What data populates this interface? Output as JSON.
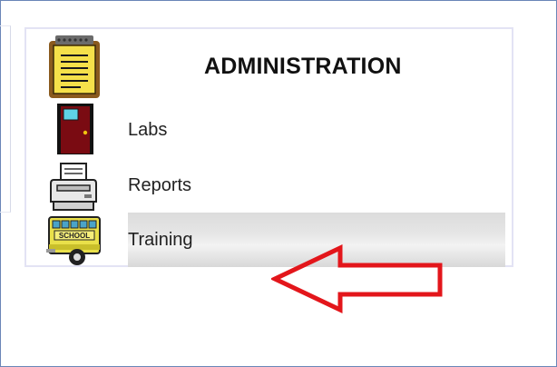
{
  "panel": {
    "title": "ADMINISTRATION"
  },
  "menu": {
    "items": [
      {
        "label": "Labs",
        "icon": "door-icon"
      },
      {
        "label": "Reports",
        "icon": "printer-icon"
      },
      {
        "label": "Training",
        "icon": "school-bus-icon",
        "highlighted": true
      }
    ],
    "header_icon": "notepad-icon"
  },
  "icons": {
    "bus_sign": "SCHOOL"
  },
  "colors": {
    "annotation_arrow": "#e3161b",
    "door": "#7a0b12",
    "notepad": "#f5e04a",
    "bus": "#e9e04a",
    "frame_border": "#6a86b7"
  }
}
